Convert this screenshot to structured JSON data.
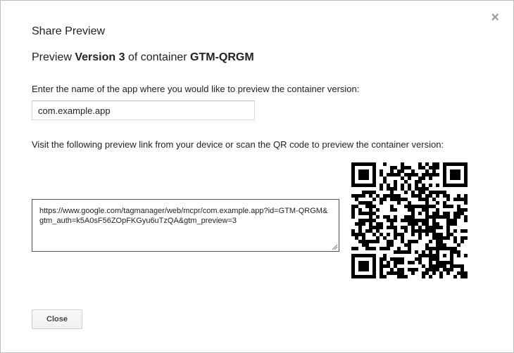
{
  "dialog": {
    "title": "Share Preview",
    "close_icon_glyph": "×",
    "subtitle": {
      "prefix": "Preview ",
      "version": "Version 3",
      "middle": " of container ",
      "container": "GTM-QRGM"
    },
    "app_prompt": "Enter the name of the app where you would like to preview the container version:",
    "app_name_value": "com.example.app",
    "link_prompt": "Visit the following preview link from your device or scan the QR code to preview the container version:",
    "preview_link": "https://www.google.com/tagmanager/web/mcpr/com.example.app?id=GTM-QRGM&gtm_auth=k5A0sF56ZOpFKGyu6uTzQA&gtm_preview=3",
    "qr_code_icon": "qr-code",
    "close_button_label": "Close"
  },
  "colors": {
    "border": "#bdbdbd",
    "text": "#222222",
    "close_icon": "#9e9e9e",
    "button_bg": "#f5f5f5"
  }
}
